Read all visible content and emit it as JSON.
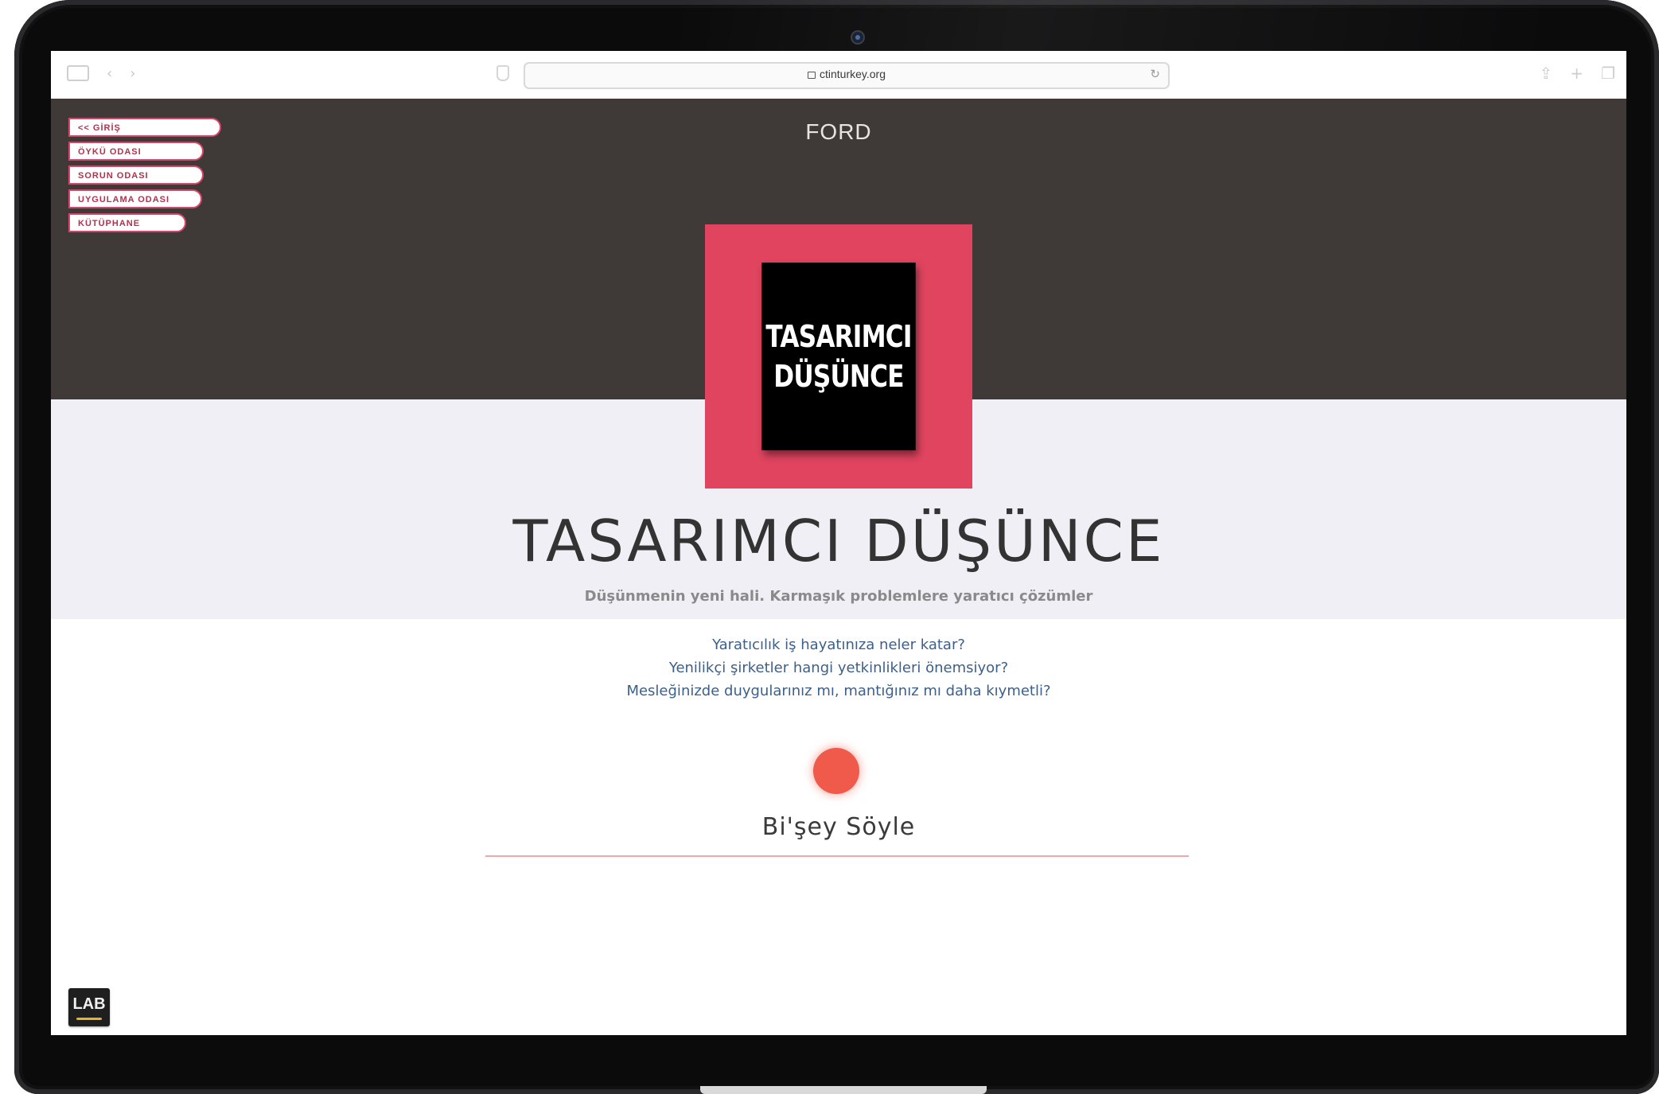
{
  "browser": {
    "url": "ctinturkey.org",
    "reload_icon": "reload-icon"
  },
  "nav": {
    "items": [
      {
        "label": "<< GİRİŞ"
      },
      {
        "label": "ÖYKÜ ODASI"
      },
      {
        "label": "SORUN ODASI"
      },
      {
        "label": "UYGULAMA ODASI"
      },
      {
        "label": "KÜTÜPHANE"
      }
    ]
  },
  "header": {
    "brand": "FORD"
  },
  "logo": {
    "line1": "TASARIMCI",
    "line2": "DÜŞÜNCE"
  },
  "main": {
    "title": "TASARIMCI DÜŞÜNCE",
    "subtitle": "Düşünmenin yeni hali. Karmaşık problemlere yaratıcı çözümler",
    "questions": [
      "Yaratıcılık iş hayatınıza neler katar?",
      "Yenilikçi şirketler hangi yetkinlikleri önemsiyor?",
      "Mesleğinizde duygularınız mı, mantığınız mı daha kıymetli?"
    ],
    "say_label": "Bi'şey Söyle"
  },
  "footer": {
    "lab_label": "LAB"
  },
  "colors": {
    "hero_bg": "#3f3a37",
    "logo_frame": "#e0445f",
    "nav_accent": "#d8456a",
    "question_text": "#3c5f8c",
    "dot": "#f05a4a"
  }
}
